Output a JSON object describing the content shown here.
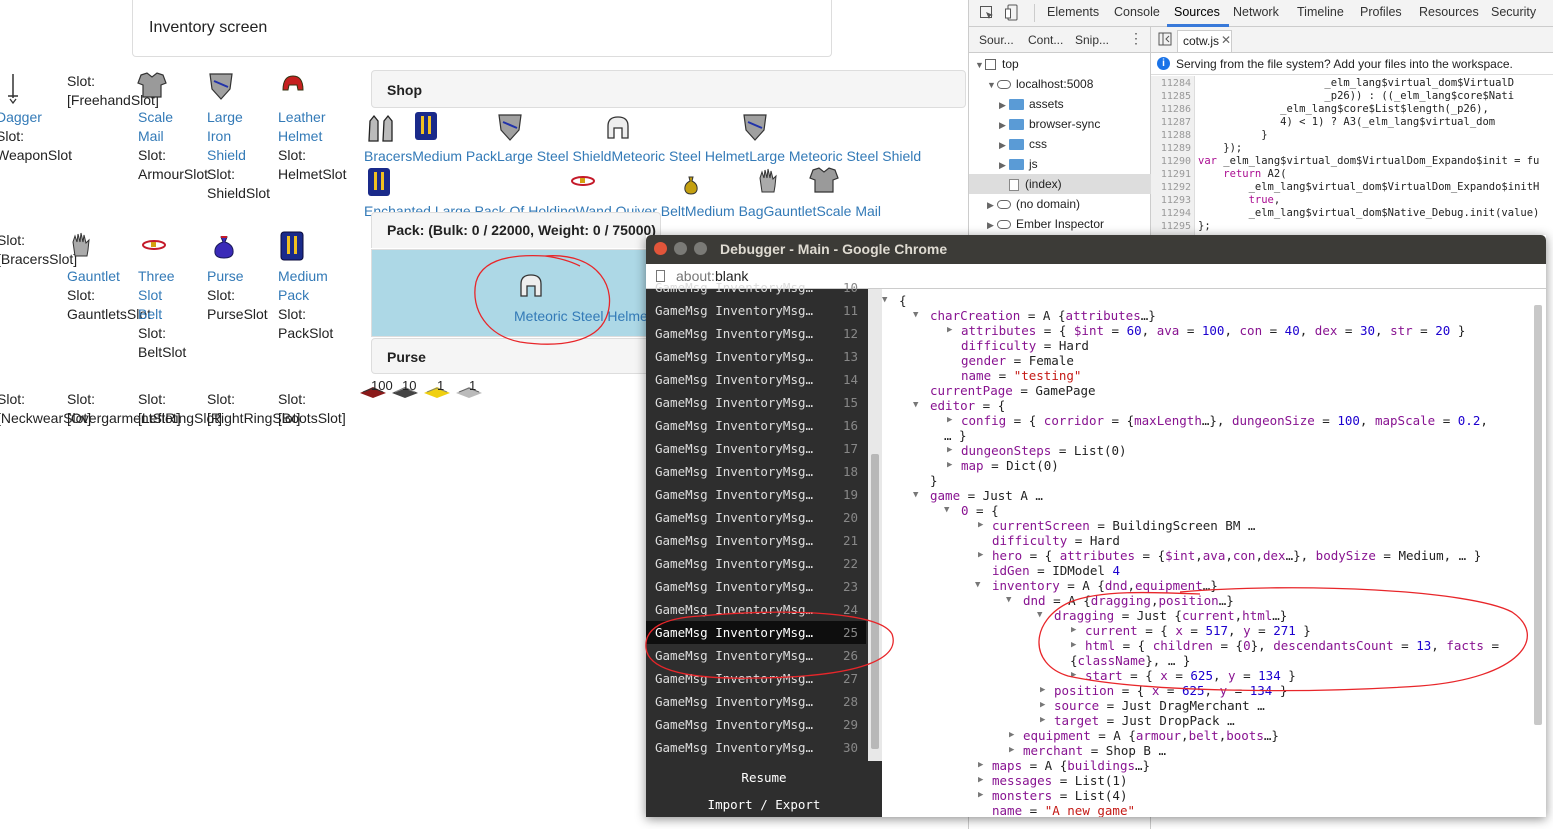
{
  "page": {
    "header_title": "Inventory screen"
  },
  "equipment_slots": {
    "row1": [
      {
        "name": "Dagger",
        "slot_label": "Slot:",
        "slot": "WeaponSlot",
        "prefix_slot": "[FreehandSlot]",
        "icon": "dagger-icon"
      },
      {
        "name": "Scale Mail",
        "slot_label": "Slot:",
        "slot": "ArmourSlot",
        "icon": "scale-mail-icon"
      },
      {
        "name": "Large Iron Shield",
        "slot_label": "Slot:",
        "slot": "ShieldSlot",
        "icon": "shield-icon"
      },
      {
        "name": "Leather Helmet",
        "slot_label": "Slot:",
        "slot": "HelmetSlot",
        "icon": "helmet-icon"
      }
    ],
    "row2": [
      {
        "name": "",
        "slot_label": "Slot:",
        "slot": "BracersSlot"
      },
      {
        "name": "Gauntlet",
        "slot_label": "Slot:",
        "slot": "GauntletsSlot",
        "icon": "gauntlet-icon"
      },
      {
        "name": "Three Slot Belt",
        "slot_label": "Slot:",
        "slot": "BeltSlot",
        "icon": "belt-icon"
      },
      {
        "name": "Purse",
        "slot_label": "Slot:",
        "slot": "PurseSlot",
        "icon": "purse-icon"
      },
      {
        "name": "Medium Pack",
        "slot_label": "Slot:",
        "slot": "PackSlot",
        "icon": "pack-icon"
      }
    ],
    "row3": [
      {
        "slot_label": "Slot:",
        "slot": "[NeckwearSlot]"
      },
      {
        "slot_label": "Slot:",
        "slot": "[OvergarmentSlot]"
      },
      {
        "slot_label": "Slot:",
        "slot": "[LeftRingSlot]"
      },
      {
        "slot_label": "Slot:",
        "slot": "[RightRingSlot]"
      },
      {
        "slot_label": "Slot:",
        "slot": "[BootsSlot]"
      }
    ]
  },
  "shop": {
    "title": "Shop",
    "items_row1": [
      "Bracers",
      "Medium Pack",
      "Large Steel Shield",
      "Meteoric Steel Helmet",
      "Large Meteoric Steel Shield"
    ],
    "items_row2": [
      "Enchanted Large Pack Of Holding",
      "Wand Quiver Belt",
      "Medium Bag",
      "Gauntlet",
      "Scale Mail"
    ]
  },
  "pack": {
    "title": "Pack: (Bulk: 0 / 22000, Weight: 0 / 75000)",
    "dragged_item": "Meteoric Steel Helmet"
  },
  "purse": {
    "title": "Purse",
    "coins": [
      "100",
      "10",
      "1",
      "1"
    ]
  },
  "devtools": {
    "tabs": [
      "Elements",
      "Console",
      "Sources",
      "Network",
      "Timeline",
      "Profiles",
      "Resources",
      "Security"
    ],
    "active_tab": "Sources",
    "nav_subtabs": [
      "Sour...",
      "Cont...",
      "Snip..."
    ],
    "file_tab": "cotw.js",
    "info": "Serving from the file system? Add your files into the workspace.",
    "tree": [
      {
        "label": "top",
        "indent": 0,
        "kind": "frame"
      },
      {
        "label": "localhost:5008",
        "indent": 1,
        "kind": "cloud"
      },
      {
        "label": "assets",
        "indent": 2,
        "kind": "folder"
      },
      {
        "label": "browser-sync",
        "indent": 2,
        "kind": "folder"
      },
      {
        "label": "css",
        "indent": 2,
        "kind": "folder"
      },
      {
        "label": "js",
        "indent": 2,
        "kind": "folder"
      },
      {
        "label": "(index)",
        "indent": 2,
        "kind": "file"
      },
      {
        "label": "(no domain)",
        "indent": 1,
        "kind": "cloud"
      },
      {
        "label": "Ember Inspector",
        "indent": 1,
        "kind": "cloud"
      }
    ],
    "line_numbers": [
      "11284",
      "11285",
      "11286",
      "11287",
      "11288",
      "11289",
      "11290",
      "11291",
      "11292",
      "11293",
      "11294",
      "11295"
    ],
    "code_lines": [
      "                    _elm_lang$virtual_dom$VirtualD",
      "                    _p26)) : ((_elm_lang$core$Nati",
      "             _elm_lang$core$List$length(_p26),",
      "             4) < 1) ? A3(_elm_lang$virtual_dom",
      "          }",
      "    });",
      "var _elm_lang$virtual_dom$VirtualDom_Expando$init = fu",
      "    return A2(",
      "        _elm_lang$virtual_dom$VirtualDom_Expando$initH",
      "        true,",
      "        _elm_lang$virtual_dom$Native_Debug.init(value)",
      "};"
    ]
  },
  "debugger": {
    "title": "Debugger - Main - Google Chrome",
    "url_prefix": "about:",
    "url_rest": "blank",
    "messages": [
      {
        "text": "GameMsg InventoryMsg…",
        "n": "10"
      },
      {
        "text": "GameMsg InventoryMsg…",
        "n": "11"
      },
      {
        "text": "GameMsg InventoryMsg…",
        "n": "12"
      },
      {
        "text": "GameMsg InventoryMsg…",
        "n": "13"
      },
      {
        "text": "GameMsg InventoryMsg…",
        "n": "14"
      },
      {
        "text": "GameMsg InventoryMsg…",
        "n": "15"
      },
      {
        "text": "GameMsg InventoryMsg…",
        "n": "16"
      },
      {
        "text": "GameMsg InventoryMsg…",
        "n": "17"
      },
      {
        "text": "GameMsg InventoryMsg…",
        "n": "18"
      },
      {
        "text": "GameMsg InventoryMsg…",
        "n": "19"
      },
      {
        "text": "GameMsg InventoryMsg…",
        "n": "20"
      },
      {
        "text": "GameMsg InventoryMsg…",
        "n": "21"
      },
      {
        "text": "GameMsg InventoryMsg…",
        "n": "22"
      },
      {
        "text": "GameMsg InventoryMsg…",
        "n": "23"
      },
      {
        "text": "GameMsg InventoryMsg…",
        "n": "24"
      },
      {
        "text": "GameMsg InventoryMsg…",
        "n": "25",
        "selected": true
      },
      {
        "text": "GameMsg InventoryMsg…",
        "n": "26"
      },
      {
        "text": "GameMsg InventoryMsg…",
        "n": "27"
      },
      {
        "text": "GameMsg InventoryMsg…",
        "n": "28"
      },
      {
        "text": "GameMsg InventoryMsg…",
        "n": "29"
      },
      {
        "text": "GameMsg InventoryMsg…",
        "n": "30"
      }
    ],
    "resume": "Resume",
    "import_export": "Import / Export",
    "model": [
      {
        "d": 0,
        "a": "down",
        "h": "{"
      },
      {
        "d": 1,
        "a": "down",
        "h": "<k>charCreation</k> = A {<k>attributes</k>…}"
      },
      {
        "d": 2,
        "a": "right",
        "h": "<k>attributes</k> = { <k>$int</k> = <n>60</n>, <k>ava</k> = <n>100</n>, <k>con</k> = <n>40</n>, <k>dex</k> = <n>30</n>, <k>str</k> = <n>20</n> }"
      },
      {
        "d": 2,
        "a": "",
        "h": "<k>difficulty</k> = Hard"
      },
      {
        "d": 2,
        "a": "",
        "h": "<k>gender</k> = Female"
      },
      {
        "d": 2,
        "a": "",
        "h": "<k>name</k> = <s>\"testing\"</s>"
      },
      {
        "d": 1,
        "a": "",
        "h": "<k>currentPage</k> = GamePage"
      },
      {
        "d": 1,
        "a": "down",
        "h": "<k>editor</k> = {"
      },
      {
        "d": 2,
        "a": "right",
        "h": "<k>config</k> = { <k>corridor</k> = {<k>maxLength</k>…}, <k>dungeonSize</k> = <n>100</n>, <k>mapScale</k> = <n>0.2</n>,"
      },
      {
        "d": -1,
        "a": "",
        "h": "… }"
      },
      {
        "d": 2,
        "a": "right",
        "h": "<k>dungeonSteps</k> = List(0)"
      },
      {
        "d": 2,
        "a": "right",
        "h": "<k>map</k> = Dict(0)"
      },
      {
        "d": 1,
        "a": "",
        "h": "}"
      },
      {
        "d": 1,
        "a": "down",
        "h": "<k>game</k> = Just A …"
      },
      {
        "d": 2,
        "a": "down",
        "h": "<k>0</k> = {"
      },
      {
        "d": 3,
        "a": "right",
        "h": "<k>currentScreen</k> = BuildingScreen BM …"
      },
      {
        "d": 3,
        "a": "",
        "h": "<k>difficulty</k> = Hard"
      },
      {
        "d": 3,
        "a": "right",
        "h": "<k>hero</k> = { <k>attributes</k> = {<k>$int</k>,<k>ava</k>,<k>con</k>,<k>dex</k>…}, <k>bodySize</k> = Medium, … }"
      },
      {
        "d": 3,
        "a": "",
        "h": "<k>idGen</k> = IDModel <n>4</n>"
      },
      {
        "d": 3,
        "a": "down",
        "h": "<k>inventory</k> = A {<k>dnd</k>,<k>equipment</k>…}"
      },
      {
        "d": 4,
        "a": "down",
        "h": "<k>dnd</k> = A {<k>dragging</k>,<k>position</k>…}"
      },
      {
        "d": 5,
        "a": "down",
        "h": "<k>dragging</k> = Just {<k>current</k>,<k>html</k>…}"
      },
      {
        "d": 6,
        "a": "right",
        "h": "<k>current</k> = { <k>x</k> = <n>517</n>, <k>y</k> = <n>271</n> }"
      },
      {
        "d": 6,
        "a": "right",
        "h": "<k>html</k> = { <k>children</k> = {<k>0</k>}, <k>descendantsCount</k> = <n>13</n>, <k>facts</k> ="
      },
      {
        "d": -2,
        "a": "",
        "h": "{<k>className</k>}, … }"
      },
      {
        "d": 6,
        "a": "right",
        "h": "<k>start</k> = { <k>x</k> = <n>625</n>, <k>y</k> = <n>134</n> }"
      },
      {
        "d": 5,
        "a": "right",
        "h": "<k>position</k> = { <k>x</k> = <n>625</n>, <k>y</k> = <n>134</n> }"
      },
      {
        "d": 5,
        "a": "right",
        "h": "<k>source</k> = Just DragMerchant …"
      },
      {
        "d": 5,
        "a": "right",
        "h": "<k>target</k> = Just DropPack …"
      },
      {
        "d": 4,
        "a": "right",
        "h": "<k>equipment</k> = A {<k>armour</k>,<k>belt</k>,<k>boots</k>…}"
      },
      {
        "d": 4,
        "a": "right",
        "h": "<k>merchant</k> = Shop B …"
      },
      {
        "d": 3,
        "a": "right",
        "h": "<k>maps</k> = A {<k>buildings</k>…}"
      },
      {
        "d": 3,
        "a": "right",
        "h": "<k>messages</k> = List(1)"
      },
      {
        "d": 3,
        "a": "right",
        "h": "<k>monsters</k> = List(4)"
      },
      {
        "d": 3,
        "a": "",
        "h": "<k>name</k> = <s>\"A new game\"</s>"
      }
    ]
  },
  "colors": {
    "link": "#337ab7",
    "annotation": "#e8262a",
    "debugger_sidebar": "#2e2e2e",
    "drop_zone": "#add8e6",
    "devtools_accent": "#3879d9"
  }
}
